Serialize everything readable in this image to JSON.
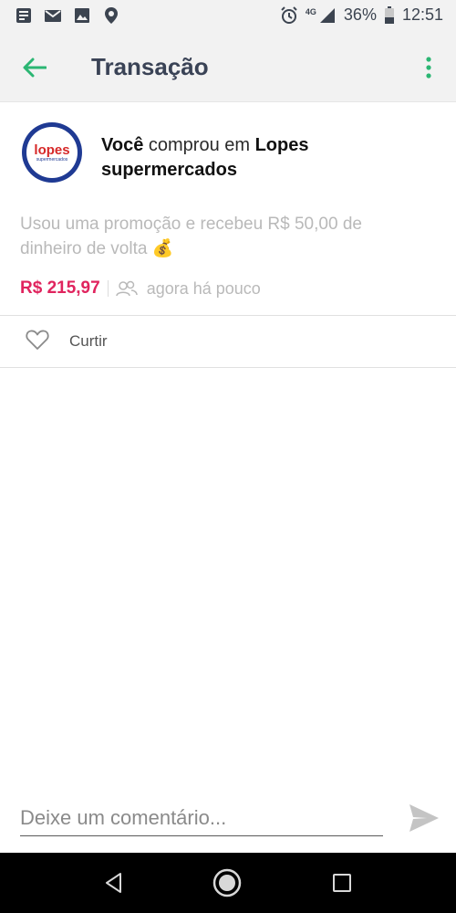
{
  "status_bar": {
    "battery_percent": "36%",
    "time": "12:51",
    "network": "4G",
    "icons_left": [
      "news-icon",
      "mail-icon",
      "image-icon",
      "location-icon"
    ],
    "icons_right": [
      "alarm-icon",
      "signal-icon",
      "battery-icon"
    ]
  },
  "app_bar": {
    "title": "Transação",
    "accent_color": "#2bb673"
  },
  "transaction": {
    "headline_prefix": "Você",
    "headline_middle": " comprou em ",
    "merchant": "Lopes supermercados",
    "logo_text": "lopes",
    "logo_subtext": "supermercados",
    "promo_text": "Usou uma promoção e recebeu R$ 50,00 de dinheiro de volta 💰",
    "amount": "R$ 215,97",
    "amount_color": "#e0245e",
    "time_text": "agora há pouco"
  },
  "actions": {
    "like_label": "Curtir"
  },
  "comment": {
    "placeholder": "Deixe um comentário..."
  }
}
